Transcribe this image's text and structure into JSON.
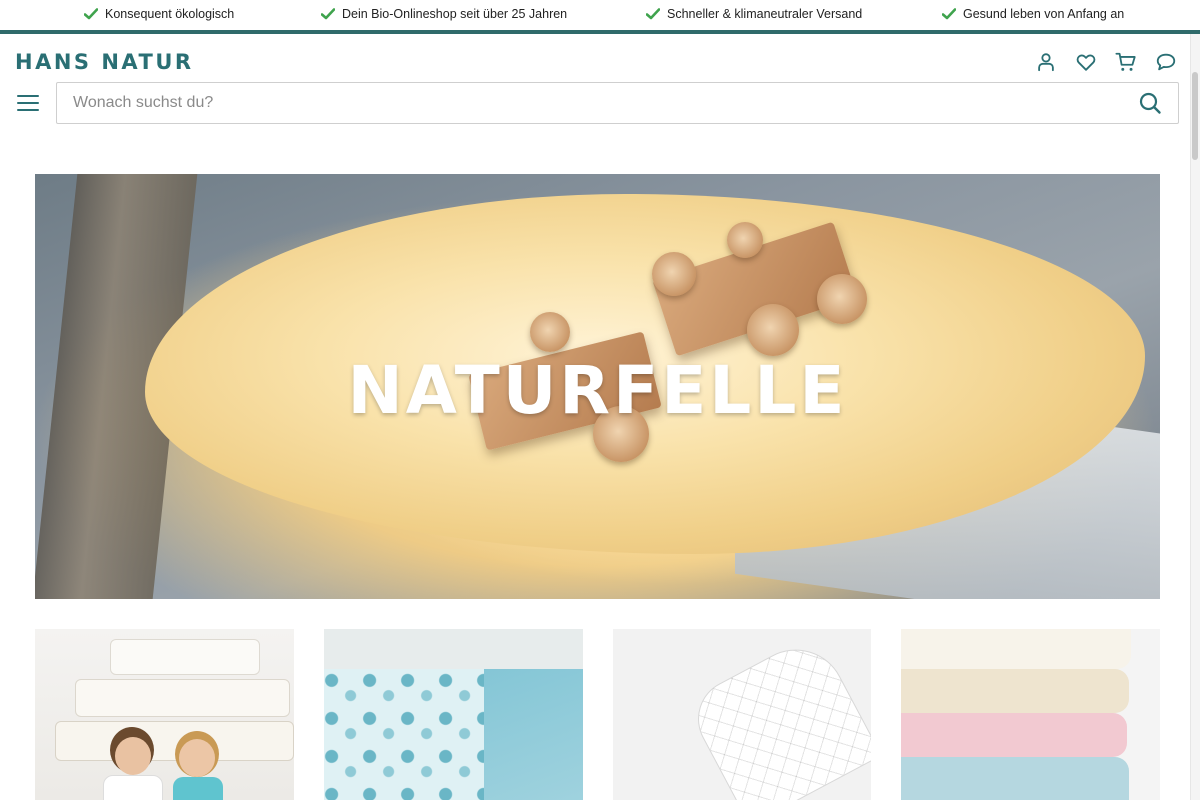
{
  "usp": [
    {
      "text": "Konsequent ökologisch",
      "icon": "check-icon"
    },
    {
      "text": "Dein Bio-Onlineshop seit über 25 Jahren",
      "icon": "check-icon"
    },
    {
      "text": "Schneller & klimaneutraler Versand",
      "icon": "check-icon"
    },
    {
      "text": "Gesund leben von Anfang an",
      "icon": "check-icon"
    }
  ],
  "colors": {
    "brand": "#2a6f74",
    "check": "#3fa34d",
    "accent_line": "#2f6b6b"
  },
  "logo": {
    "text": "HANS NATUR"
  },
  "header_icons": [
    "account-icon",
    "wishlist-heart-icon",
    "cart-icon",
    "chat-icon"
  ],
  "search": {
    "placeholder": "Wonach suchst du?",
    "value": ""
  },
  "hero": {
    "title": "NATURFELLE"
  },
  "tiles": [
    {
      "name": "matratzen-tile"
    },
    {
      "name": "bettwaesche-tile"
    },
    {
      "name": "matratzenauflage-tile"
    },
    {
      "name": "spannbettlaken-tile"
    }
  ]
}
